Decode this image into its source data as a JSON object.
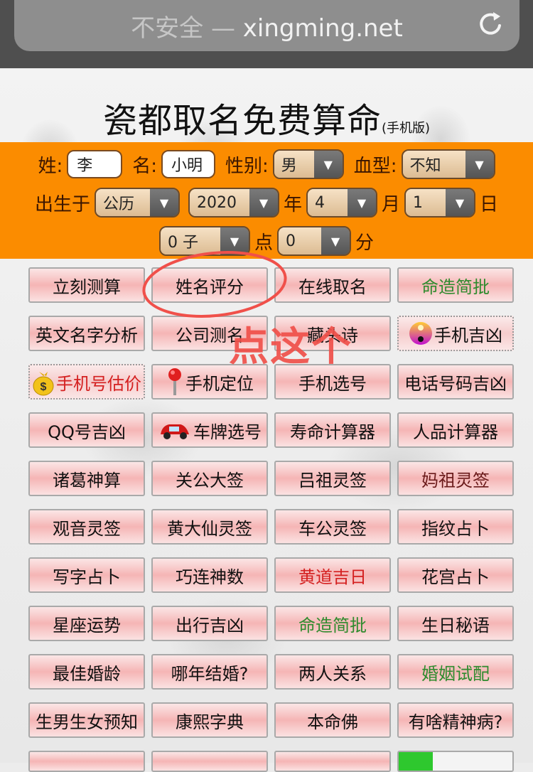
{
  "browser": {
    "security_label": "不安全",
    "separator": " — ",
    "host": "xingming.net"
  },
  "header": {
    "title": "瓷都取名免费算命",
    "subtitle": "(手机版)"
  },
  "form": {
    "surname_label": "姓:",
    "surname_value": "李",
    "name_label": "名:",
    "name_value": "小明",
    "gender_label": "性别:",
    "gender_value": "男",
    "blood_label": "血型:",
    "blood_value": "不知",
    "born_label": "出生于",
    "calendar_value": "公历",
    "year_value": "2020",
    "year_label": "年",
    "month_value": "4",
    "month_label": "月",
    "day_value": "1",
    "day_label": "日",
    "hour_value": "0 子",
    "hour_label": "点",
    "minute_value": "0",
    "minute_label": "分"
  },
  "colors": {
    "form_bg": "#fb8c00",
    "green_label": "#2e8b2e",
    "red_label": "#d42020",
    "annotation": "#f0504a"
  },
  "buttons": [
    {
      "label": "立刻测算",
      "color": "default"
    },
    {
      "label": "姓名评分",
      "color": "default"
    },
    {
      "label": "在线取名",
      "color": "default"
    },
    {
      "label": "命造简批",
      "color": "green"
    },
    {
      "label": "英文名字分析",
      "color": "default"
    },
    {
      "label": "公司测名",
      "color": "default"
    },
    {
      "label": "藏头诗",
      "color": "default"
    },
    {
      "label": "手机吉凶",
      "color": "default",
      "icon": "yin-yang-icon"
    },
    {
      "label": "手机号估价",
      "color": "red",
      "icon": "money-bag-icon"
    },
    {
      "label": "手机定位",
      "color": "default",
      "icon": "map-pin-icon"
    },
    {
      "label": "手机选号",
      "color": "default"
    },
    {
      "label": "电话号码吉凶",
      "color": "default"
    },
    {
      "label": "QQ号吉凶",
      "color": "default"
    },
    {
      "label": "车牌选号",
      "color": "default",
      "icon": "car-icon"
    },
    {
      "label": "寿命计算器",
      "color": "default"
    },
    {
      "label": "人品计算器",
      "color": "default"
    },
    {
      "label": "诸葛神算",
      "color": "default"
    },
    {
      "label": "关公大签",
      "color": "default"
    },
    {
      "label": "吕祖灵签",
      "color": "default"
    },
    {
      "label": "妈祖灵签",
      "color": "maroon"
    },
    {
      "label": "观音灵签",
      "color": "default"
    },
    {
      "label": "黄大仙灵签",
      "color": "default"
    },
    {
      "label": "车公灵签",
      "color": "default"
    },
    {
      "label": "指纹占卜",
      "color": "default"
    },
    {
      "label": "写字占卜",
      "color": "default"
    },
    {
      "label": "巧连神数",
      "color": "default"
    },
    {
      "label": "黄道吉日",
      "color": "red"
    },
    {
      "label": "花宫占卜",
      "color": "default"
    },
    {
      "label": "星座运势",
      "color": "default"
    },
    {
      "label": "出行吉凶",
      "color": "default"
    },
    {
      "label": "命造简批",
      "color": "green"
    },
    {
      "label": "生日秘语",
      "color": "default"
    },
    {
      "label": "最佳婚龄",
      "color": "default"
    },
    {
      "label": "哪年结婚?",
      "color": "default"
    },
    {
      "label": "两人关系",
      "color": "default"
    },
    {
      "label": "婚姻试配",
      "color": "green"
    },
    {
      "label": "生男生女预知",
      "color": "default"
    },
    {
      "label": "康熙字典",
      "color": "default"
    },
    {
      "label": "本命佛",
      "color": "default"
    },
    {
      "label": "有啥精神病?",
      "color": "default"
    }
  ],
  "annotation": {
    "text": "点这个",
    "target": "姓名评分"
  }
}
